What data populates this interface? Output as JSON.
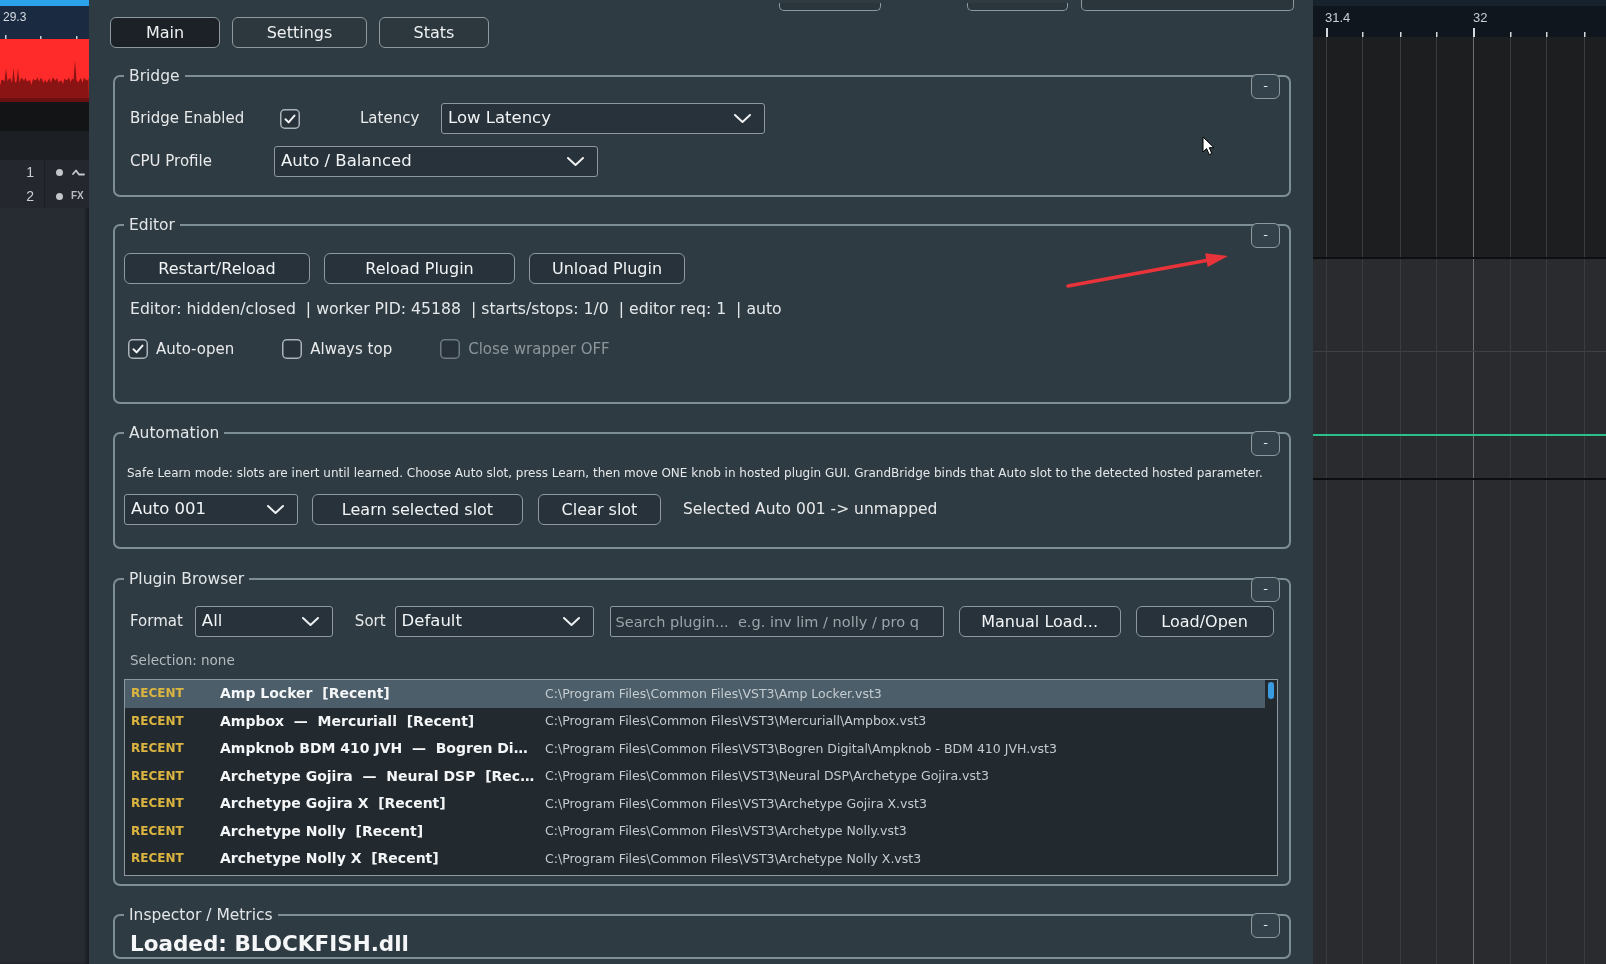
{
  "daw_left": {
    "ruler_label": "29.3",
    "tracks": [
      {
        "number": "1",
        "kind": "wave"
      },
      {
        "number": "2",
        "kind": "fx",
        "label": "FX"
      }
    ]
  },
  "tabs": [
    {
      "label": "Main",
      "selected": true
    },
    {
      "label": "Settings",
      "selected": false
    },
    {
      "label": "Stats",
      "selected": false
    }
  ],
  "bridge": {
    "title": "Bridge",
    "collapse": "-",
    "enabled_label": "Bridge Enabled",
    "enabled": true,
    "latency_label": "Latency",
    "latency": "Low Latency",
    "cpu_profile_label": "CPU Profile",
    "cpu_profile": "Auto / Balanced"
  },
  "editor": {
    "title": "Editor",
    "collapse": "-",
    "buttons": [
      "Restart/Reload",
      "Reload Plugin",
      "Unload Plugin"
    ],
    "status": "Editor: hidden/closed  | worker PID: 45188  | starts/stops: 1/0  | editor req: 1  | auto",
    "options": [
      {
        "label": "Auto-open",
        "checked": true,
        "disabled": false
      },
      {
        "label": "Always top",
        "checked": false,
        "disabled": false
      },
      {
        "label": "Close wrapper OFF",
        "checked": false,
        "disabled": true
      }
    ]
  },
  "automation": {
    "title": "Automation",
    "collapse": "-",
    "hint": "Safe Learn mode: slots are inert until learned. Choose Auto slot, press Learn, then move ONE knob in hosted plugin GUI. GrandBridge binds that Auto slot to the detected hosted parameter.",
    "slot": "Auto 001",
    "buttons": [
      "Learn selected slot",
      "Clear slot"
    ],
    "mapping": "Selected Auto 001 -> unmapped"
  },
  "plugin_browser": {
    "title": "Plugin Browser",
    "collapse": "-",
    "format_label": "Format",
    "format": "All",
    "sort_label": "Sort",
    "sort": "Default",
    "search": {
      "placeholder": "Search plugin...  e.g. inv lim / nolly / pro q"
    },
    "buttons": [
      "Manual Load...",
      "Load/Open"
    ],
    "selection": "Selection: none",
    "plugins": [
      {
        "tag": "RECENT",
        "name": "Amp Locker  [Recent]",
        "path": "C:\\Program Files\\Common Files\\VST3\\Amp Locker.vst3",
        "selected": true
      },
      {
        "tag": "RECENT",
        "name": "Ampbox  —  Mercuriall  [Recent]",
        "path": "C:\\Program Files\\Common Files\\VST3\\Mercuriall\\Ampbox.vst3",
        "selected": false
      },
      {
        "tag": "RECENT",
        "name": "Ampknob BDM 410 JVH  —  Bogren Di…",
        "path": "C:\\Program Files\\Common Files\\VST3\\Bogren Digital\\Ampknob - BDM 410 JVH.vst3",
        "selected": false
      },
      {
        "tag": "RECENT",
        "name": "Archetype Gojira  —  Neural DSP  [Rec…",
        "path": "C:\\Program Files\\Common Files\\VST3\\Neural DSP\\Archetype Gojira.vst3",
        "selected": false
      },
      {
        "tag": "RECENT",
        "name": "Archetype Gojira X  [Recent]",
        "path": "C:\\Program Files\\Common Files\\VST3\\Archetype Gojira X.vst3",
        "selected": false
      },
      {
        "tag": "RECENT",
        "name": "Archetype Nolly  [Recent]",
        "path": "C:\\Program Files\\Common Files\\VST3\\Archetype Nolly.vst3",
        "selected": false
      },
      {
        "tag": "RECENT",
        "name": "Archetype Nolly X  [Recent]",
        "path": "C:\\Program Files\\Common Files\\VST3\\Archetype Nolly X.vst3",
        "selected": false
      }
    ]
  },
  "inspector": {
    "title": "Inspector / Metrics",
    "collapse": "-",
    "loaded": "Loaded: BLOCKFISH.dll"
  },
  "daw_right": {
    "ruler_labels": [
      "31.4",
      "32"
    ]
  }
}
